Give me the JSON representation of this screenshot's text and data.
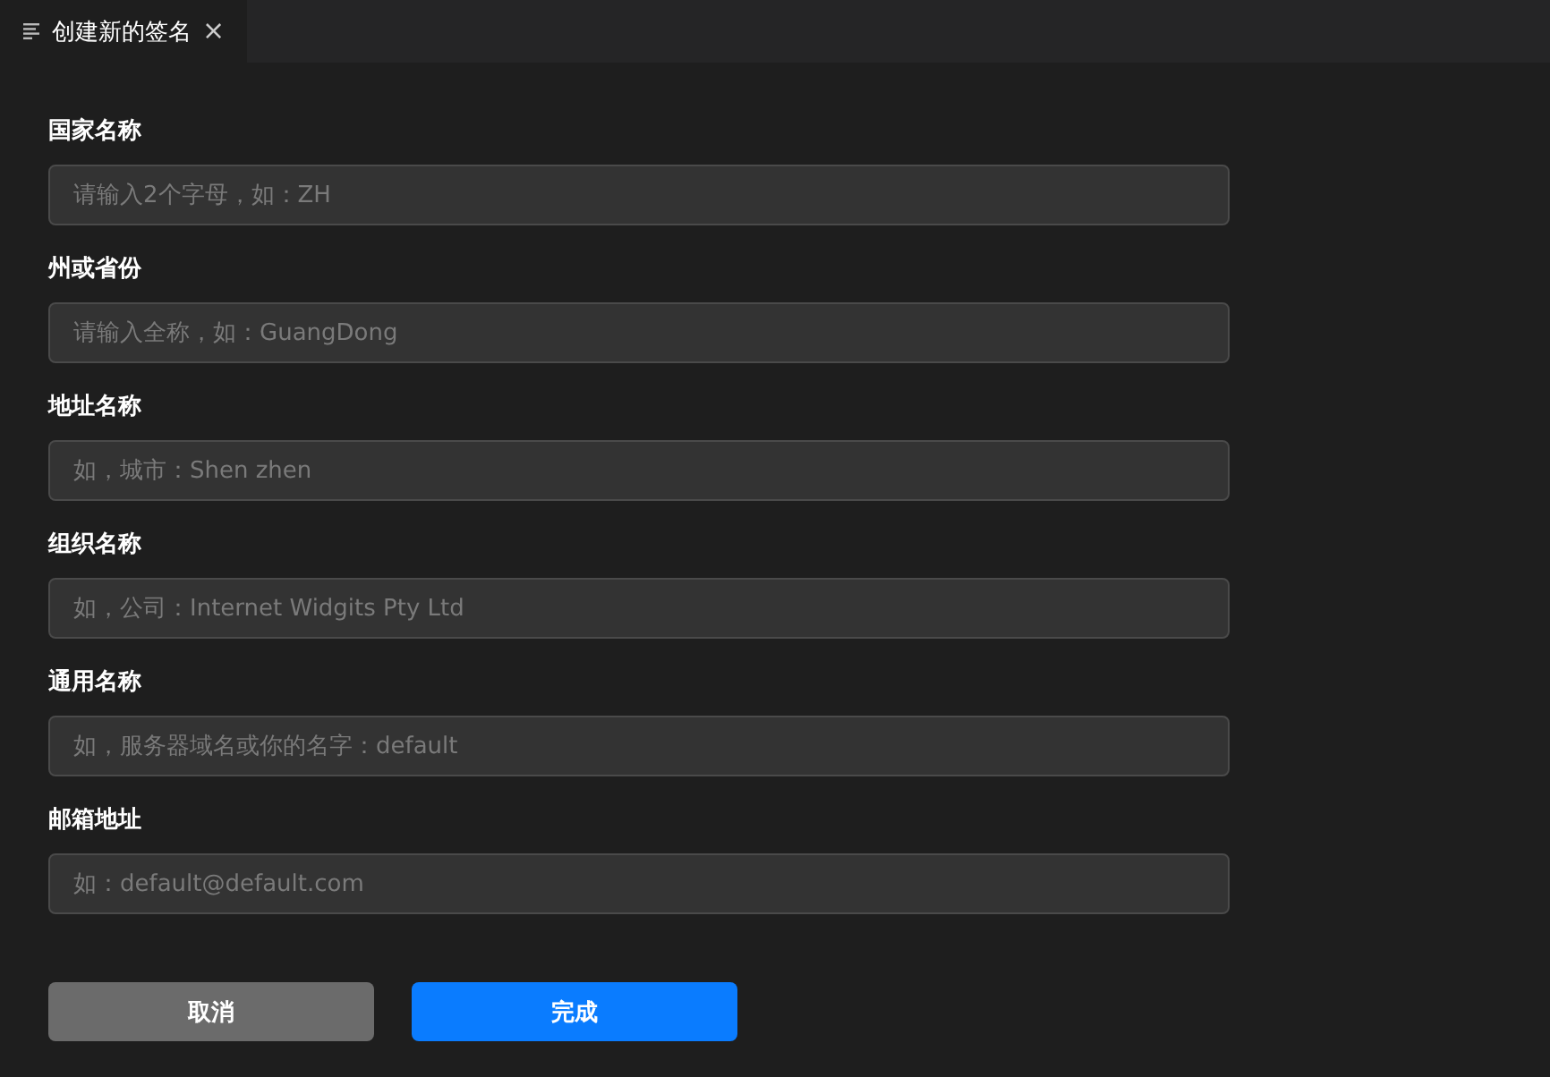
{
  "tabs": [
    {
      "label": "创建新的签名",
      "close": "×",
      "selected": true
    }
  ],
  "fields": [
    {
      "label": "国家名称",
      "placeholder": "请输入2个字母，如：ZH"
    },
    {
      "label": "州或省份",
      "placeholder": "请输入全称，如：GuangDong"
    },
    {
      "label": "地址名称",
      "placeholder": "如，城市：Shen zhen"
    },
    {
      "label": "组织名称",
      "placeholder": "如，公司：Internet Widgits Pty Ltd"
    },
    {
      "label": "通用名称",
      "placeholder": "如，服务器域名或你的名字：default"
    },
    {
      "label": "邮箱地址",
      "placeholder": "如：default@default.com"
    }
  ],
  "buttons": [
    {
      "label": "取消",
      "kind": "secondary"
    },
    {
      "label": "完成",
      "kind": "primary"
    }
  ]
}
